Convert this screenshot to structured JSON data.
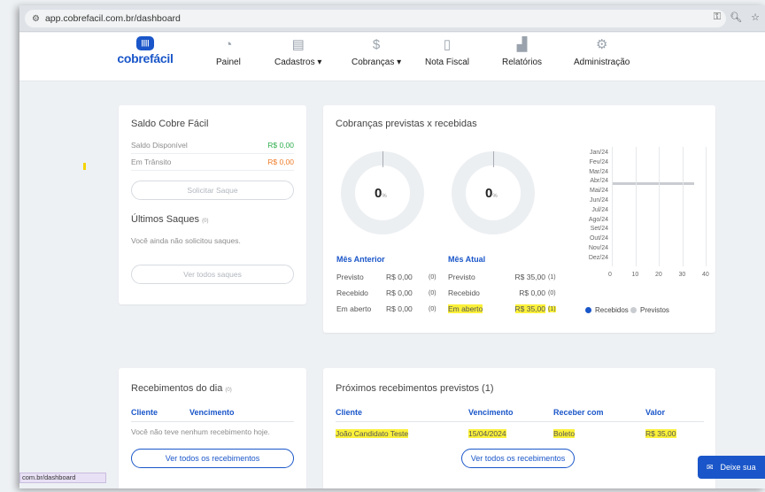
{
  "browser": {
    "url": "app.cobrefacil.com.br/dashboard",
    "site_icon": "site-settings-icon",
    "icons": [
      "key-icon",
      "zoom-icon",
      "star-icon"
    ],
    "status_url": "com.br/dashboard"
  },
  "brand": {
    "name": "cobrefácil",
    "badge": "||||",
    "color": "#1a56c9"
  },
  "nav": [
    {
      "label": "Painel",
      "icon": "gauge-icon"
    },
    {
      "label": "Cadastros ▾",
      "icon": "id-card-icon"
    },
    {
      "label": "Cobranças ▾",
      "icon": "money-bag-icon"
    },
    {
      "label": "Nota Fiscal",
      "icon": "document-icon"
    },
    {
      "label": "Relatórios",
      "icon": "bar-chart-icon"
    },
    {
      "label": "Administração",
      "icon": "gear-icon"
    }
  ],
  "saldo": {
    "title": "Saldo Cobre Fácil",
    "disponivel_label": "Saldo Disponível",
    "disponivel_value": "R$ 0,00",
    "transito_label": "Em Trânsito",
    "transito_value": "R$ 0,00",
    "saque_button": "Solicitar Saque",
    "ultimos_title": "Últimos Saques",
    "ultimos_count": "(0)",
    "ultimos_empty": "Você ainda não solicitou saques.",
    "ver_todos": "Ver todos saques"
  },
  "cobrancas": {
    "title": "Cobranças previstas x recebidas",
    "donut_anterior": "0",
    "donut_atual": "0",
    "donut_unit": "%",
    "mes_anterior": {
      "title": "Mês Anterior",
      "rows": [
        {
          "label": "Previsto",
          "value": "R$ 0,00",
          "count": "(0)"
        },
        {
          "label": "Recebido",
          "value": "R$ 0,00",
          "count": "(0)"
        },
        {
          "label": "Em aberto",
          "value": "R$ 0,00",
          "count": "(0)"
        }
      ]
    },
    "mes_atual": {
      "title": "Mês Atual",
      "rows": [
        {
          "label": "Previsto",
          "value": "R$ 35,00",
          "count": "(1)"
        },
        {
          "label": "Recebido",
          "value": "R$ 0,00",
          "count": "(0)"
        },
        {
          "label": "Em aberto",
          "value": "R$ 35,00",
          "count": "(1)"
        }
      ]
    }
  },
  "chart_data": {
    "type": "bar",
    "orientation": "horizontal",
    "categories": [
      "Jan/24",
      "Fev/24",
      "Mar/24",
      "Abr/24",
      "Mai/24",
      "Jun/24",
      "Jul/24",
      "Ago/24",
      "Set/24",
      "Out/24",
      "Nov/24",
      "Dez/24"
    ],
    "series": [
      {
        "name": "Recebidos",
        "color": "#1a56c9",
        "values": [
          0,
          0,
          0,
          0,
          0,
          0,
          0,
          0,
          0,
          0,
          0,
          0
        ]
      },
      {
        "name": "Previstos",
        "color": "#c9ccd0",
        "values": [
          0,
          0,
          0,
          35,
          0,
          0,
          0,
          0,
          0,
          0,
          0,
          0
        ]
      }
    ],
    "xticks": [
      "0",
      "10",
      "20",
      "30",
      "40"
    ],
    "xlim": [
      0,
      40
    ],
    "legend": "bottom"
  },
  "recebimentos_dia": {
    "title": "Recebimentos do dia",
    "count": "(0)",
    "headers": [
      "Cliente",
      "Vencimento"
    ],
    "empty": "Você não teve nenhum recebimento hoje.",
    "button": "Ver todos os recebimentos"
  },
  "proximos": {
    "title": "Próximos recebimentos previstos (1)",
    "headers": [
      "Cliente",
      "Vencimento",
      "Receber com",
      "Valor"
    ],
    "rows": [
      {
        "cliente": "João Candidato Teste",
        "vencimento": "15/04/2024",
        "receber_com": "Boleto",
        "valor": "R$ 35,00"
      }
    ],
    "button": "Ver todos os recebimentos"
  },
  "feedback": {
    "label": "Deixe sua",
    "icon": "mail-icon"
  }
}
